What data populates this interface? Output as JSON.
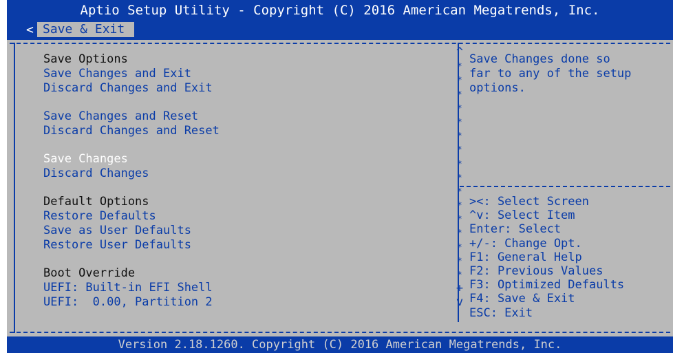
{
  "header": {
    "title": "Aptio Setup Utility - Copyright (C) 2016 American Megatrends, Inc.",
    "tab_arrow": "<",
    "active_tab": "Save & Exit"
  },
  "menu": {
    "save_options_heading": "Save Options",
    "save_changes_and_exit": "Save Changes and Exit",
    "discard_changes_and_exit": "Discard Changes and Exit",
    "save_changes_and_reset": "Save Changes and Reset",
    "discard_changes_and_reset": "Discard Changes and Reset",
    "save_changes": "Save Changes",
    "discard_changes": "Discard Changes",
    "default_options_heading": "Default Options",
    "restore_defaults": "Restore Defaults",
    "save_as_user_defaults": "Save as User Defaults",
    "restore_user_defaults": "Restore User Defaults",
    "boot_override_heading": "Boot Override",
    "boot_uefi_shell": "UEFI: Built-in EFI Shell",
    "boot_uefi_partition": "UEFI:  0.00, Partition 2"
  },
  "scrollbar": {
    "up": "^",
    "thumb": "+",
    "down": "v",
    "track": "*"
  },
  "help": {
    "line1": "Save Changes done so",
    "line2": "far to any of the setup",
    "line3": "options."
  },
  "keys": {
    "select_screen": "><: Select Screen",
    "select_item": "^v: Select Item",
    "enter": "Enter: Select",
    "change_opt": "+/-: Change Opt.",
    "f1": "F1: General Help",
    "f2": "F2: Previous Values",
    "f3": "F3: Optimized Defaults",
    "f4": "F4: Save & Exit",
    "esc": "ESC: Exit"
  },
  "footer": {
    "text": "Version 2.18.1260. Copyright (C) 2016 American Megatrends, Inc."
  },
  "colors": {
    "bios_blue": "#0a3ca8",
    "panel_gray": "#b9b9b9",
    "highlight": "#ffffff"
  }
}
